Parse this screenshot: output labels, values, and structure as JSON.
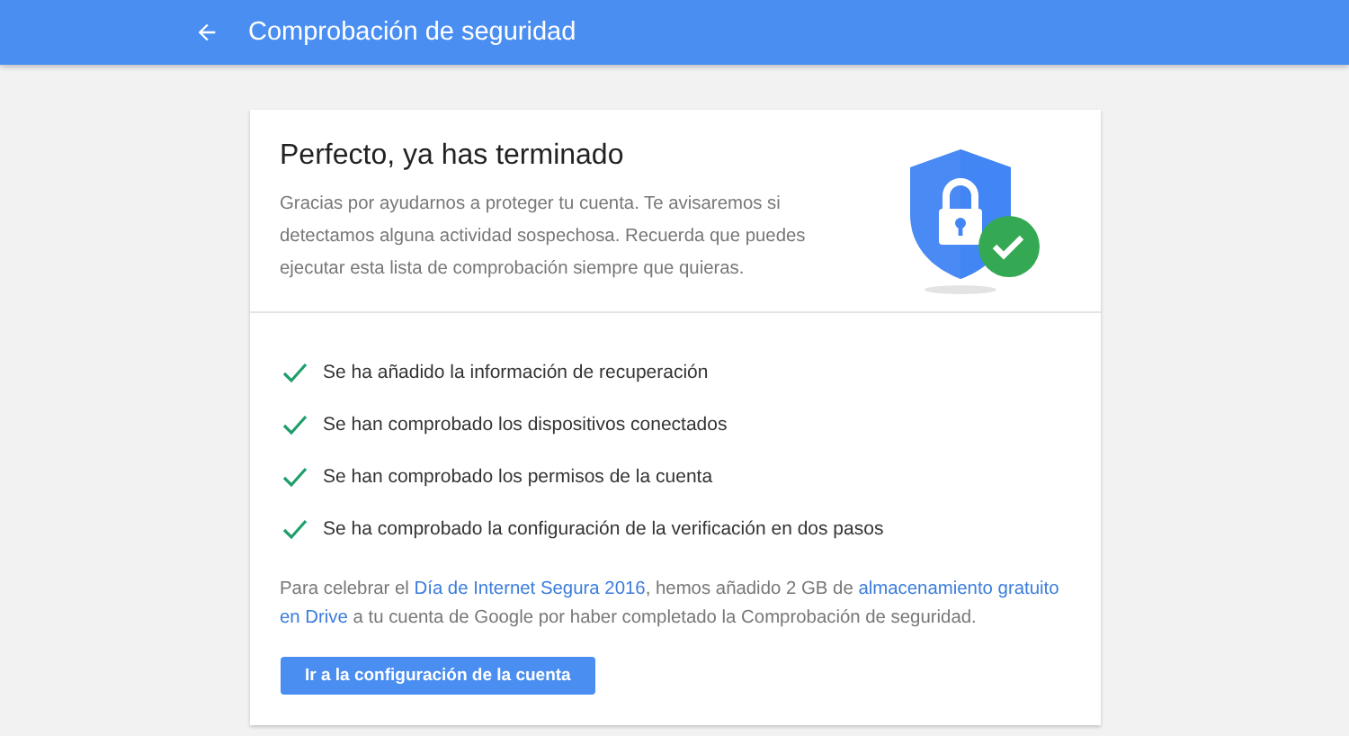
{
  "app_bar": {
    "title": "Comprobación de seguridad"
  },
  "card": {
    "title": "Perfecto, ya has terminado",
    "description": "Gracias por ayudarnos a proteger tu cuenta. Te avisaremos si detectamos alguna actividad sospechosa. Recuerda que puedes ejecutar esta lista de comprobación siempre que quieras.",
    "checklist": [
      {
        "text": "Se ha añadido la información de recuperación",
        "checked": true
      },
      {
        "text": "Se han comprobado los dispositivos conectados",
        "checked": true
      },
      {
        "text": "Se han comprobado los permisos de la cuenta",
        "checked": true
      },
      {
        "text": "Se ha comprobado la configuración de la verificación en dos pasos",
        "checked": true
      }
    ],
    "note": [
      {
        "kind": "text",
        "text": "Para celebrar el "
      },
      {
        "kind": "link",
        "text": "Día de Internet Segura 2016"
      },
      {
        "kind": "text",
        "text": ", hemos añadido 2 GB de "
      },
      {
        "kind": "link",
        "text": "almacenamiento gratuito "
      },
      {
        "kind": "link",
        "text": "en Drive"
      },
      {
        "kind": "text",
        "text": " a tu cuenta de Google por haber completado la Comprobación de seguridad."
      }
    ],
    "button": "Ir a la configuración de la cuenta"
  }
}
